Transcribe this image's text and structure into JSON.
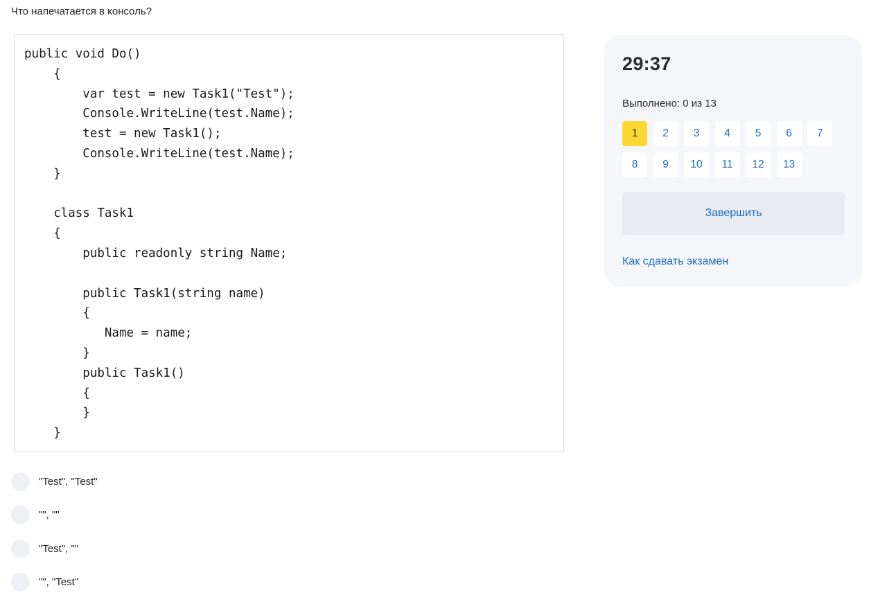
{
  "question": {
    "text": "Что напечатается в консоль?"
  },
  "code": "public void Do()\n    {\n        var test = new Task1(\"Test\");\n        Console.WriteLine(test.Name);\n        test = new Task1();\n        Console.WriteLine(test.Name);\n    }\n\n    class Task1\n    {\n        public readonly string Name;\n\n        public Task1(string name)\n        {\n           Name = name;\n        }\n        public Task1()\n        {\n        }\n    }",
  "answers": [
    "\"Test\", \"Test\"",
    "\"\", \"\"",
    "\"Test\", \"\"",
    "\"\", \"Test\""
  ],
  "panel": {
    "timer": "29:37",
    "progress": "Выполнено: 0 из 13",
    "question_numbers": [
      "1",
      "2",
      "3",
      "4",
      "5",
      "6",
      "7",
      "8",
      "9",
      "10",
      "11",
      "12",
      "13"
    ],
    "active_question": "1",
    "finish_label": "Завершить",
    "help_link": "Как сдавать экзамен"
  },
  "colors": {
    "accent": "#1a6ec8",
    "active": "#fcd734",
    "panel_bg": "#f4f6f9",
    "radio_bg": "#eef0f4"
  }
}
